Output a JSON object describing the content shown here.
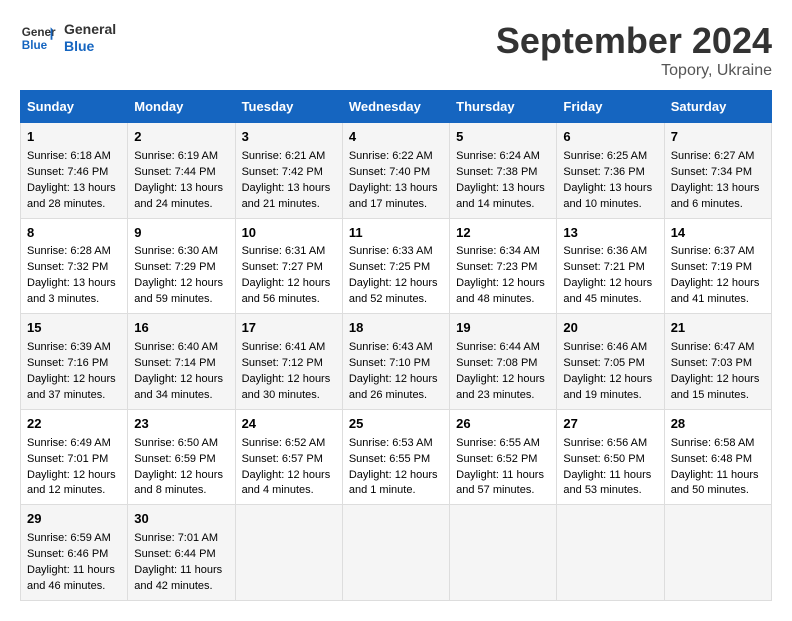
{
  "header": {
    "logo_line1": "General",
    "logo_line2": "Blue",
    "month_title": "September 2024",
    "location": "Topory, Ukraine"
  },
  "days_of_week": [
    "Sunday",
    "Monday",
    "Tuesday",
    "Wednesday",
    "Thursday",
    "Friday",
    "Saturday"
  ],
  "weeks": [
    [
      {
        "day": 1,
        "lines": [
          "Sunrise: 6:18 AM",
          "Sunset: 7:46 PM",
          "Daylight: 13 hours",
          "and 28 minutes."
        ]
      },
      {
        "day": 2,
        "lines": [
          "Sunrise: 6:19 AM",
          "Sunset: 7:44 PM",
          "Daylight: 13 hours",
          "and 24 minutes."
        ]
      },
      {
        "day": 3,
        "lines": [
          "Sunrise: 6:21 AM",
          "Sunset: 7:42 PM",
          "Daylight: 13 hours",
          "and 21 minutes."
        ]
      },
      {
        "day": 4,
        "lines": [
          "Sunrise: 6:22 AM",
          "Sunset: 7:40 PM",
          "Daylight: 13 hours",
          "and 17 minutes."
        ]
      },
      {
        "day": 5,
        "lines": [
          "Sunrise: 6:24 AM",
          "Sunset: 7:38 PM",
          "Daylight: 13 hours",
          "and 14 minutes."
        ]
      },
      {
        "day": 6,
        "lines": [
          "Sunrise: 6:25 AM",
          "Sunset: 7:36 PM",
          "Daylight: 13 hours",
          "and 10 minutes."
        ]
      },
      {
        "day": 7,
        "lines": [
          "Sunrise: 6:27 AM",
          "Sunset: 7:34 PM",
          "Daylight: 13 hours",
          "and 6 minutes."
        ]
      }
    ],
    [
      {
        "day": 8,
        "lines": [
          "Sunrise: 6:28 AM",
          "Sunset: 7:32 PM",
          "Daylight: 13 hours",
          "and 3 minutes."
        ]
      },
      {
        "day": 9,
        "lines": [
          "Sunrise: 6:30 AM",
          "Sunset: 7:29 PM",
          "Daylight: 12 hours",
          "and 59 minutes."
        ]
      },
      {
        "day": 10,
        "lines": [
          "Sunrise: 6:31 AM",
          "Sunset: 7:27 PM",
          "Daylight: 12 hours",
          "and 56 minutes."
        ]
      },
      {
        "day": 11,
        "lines": [
          "Sunrise: 6:33 AM",
          "Sunset: 7:25 PM",
          "Daylight: 12 hours",
          "and 52 minutes."
        ]
      },
      {
        "day": 12,
        "lines": [
          "Sunrise: 6:34 AM",
          "Sunset: 7:23 PM",
          "Daylight: 12 hours",
          "and 48 minutes."
        ]
      },
      {
        "day": 13,
        "lines": [
          "Sunrise: 6:36 AM",
          "Sunset: 7:21 PM",
          "Daylight: 12 hours",
          "and 45 minutes."
        ]
      },
      {
        "day": 14,
        "lines": [
          "Sunrise: 6:37 AM",
          "Sunset: 7:19 PM",
          "Daylight: 12 hours",
          "and 41 minutes."
        ]
      }
    ],
    [
      {
        "day": 15,
        "lines": [
          "Sunrise: 6:39 AM",
          "Sunset: 7:16 PM",
          "Daylight: 12 hours",
          "and 37 minutes."
        ]
      },
      {
        "day": 16,
        "lines": [
          "Sunrise: 6:40 AM",
          "Sunset: 7:14 PM",
          "Daylight: 12 hours",
          "and 34 minutes."
        ]
      },
      {
        "day": 17,
        "lines": [
          "Sunrise: 6:41 AM",
          "Sunset: 7:12 PM",
          "Daylight: 12 hours",
          "and 30 minutes."
        ]
      },
      {
        "day": 18,
        "lines": [
          "Sunrise: 6:43 AM",
          "Sunset: 7:10 PM",
          "Daylight: 12 hours",
          "and 26 minutes."
        ]
      },
      {
        "day": 19,
        "lines": [
          "Sunrise: 6:44 AM",
          "Sunset: 7:08 PM",
          "Daylight: 12 hours",
          "and 23 minutes."
        ]
      },
      {
        "day": 20,
        "lines": [
          "Sunrise: 6:46 AM",
          "Sunset: 7:05 PM",
          "Daylight: 12 hours",
          "and 19 minutes."
        ]
      },
      {
        "day": 21,
        "lines": [
          "Sunrise: 6:47 AM",
          "Sunset: 7:03 PM",
          "Daylight: 12 hours",
          "and 15 minutes."
        ]
      }
    ],
    [
      {
        "day": 22,
        "lines": [
          "Sunrise: 6:49 AM",
          "Sunset: 7:01 PM",
          "Daylight: 12 hours",
          "and 12 minutes."
        ]
      },
      {
        "day": 23,
        "lines": [
          "Sunrise: 6:50 AM",
          "Sunset: 6:59 PM",
          "Daylight: 12 hours",
          "and 8 minutes."
        ]
      },
      {
        "day": 24,
        "lines": [
          "Sunrise: 6:52 AM",
          "Sunset: 6:57 PM",
          "Daylight: 12 hours",
          "and 4 minutes."
        ]
      },
      {
        "day": 25,
        "lines": [
          "Sunrise: 6:53 AM",
          "Sunset: 6:55 PM",
          "Daylight: 12 hours",
          "and 1 minute."
        ]
      },
      {
        "day": 26,
        "lines": [
          "Sunrise: 6:55 AM",
          "Sunset: 6:52 PM",
          "Daylight: 11 hours",
          "and 57 minutes."
        ]
      },
      {
        "day": 27,
        "lines": [
          "Sunrise: 6:56 AM",
          "Sunset: 6:50 PM",
          "Daylight: 11 hours",
          "and 53 minutes."
        ]
      },
      {
        "day": 28,
        "lines": [
          "Sunrise: 6:58 AM",
          "Sunset: 6:48 PM",
          "Daylight: 11 hours",
          "and 50 minutes."
        ]
      }
    ],
    [
      {
        "day": 29,
        "lines": [
          "Sunrise: 6:59 AM",
          "Sunset: 6:46 PM",
          "Daylight: 11 hours",
          "and 46 minutes."
        ]
      },
      {
        "day": 30,
        "lines": [
          "Sunrise: 7:01 AM",
          "Sunset: 6:44 PM",
          "Daylight: 11 hours",
          "and 42 minutes."
        ]
      },
      null,
      null,
      null,
      null,
      null
    ]
  ]
}
